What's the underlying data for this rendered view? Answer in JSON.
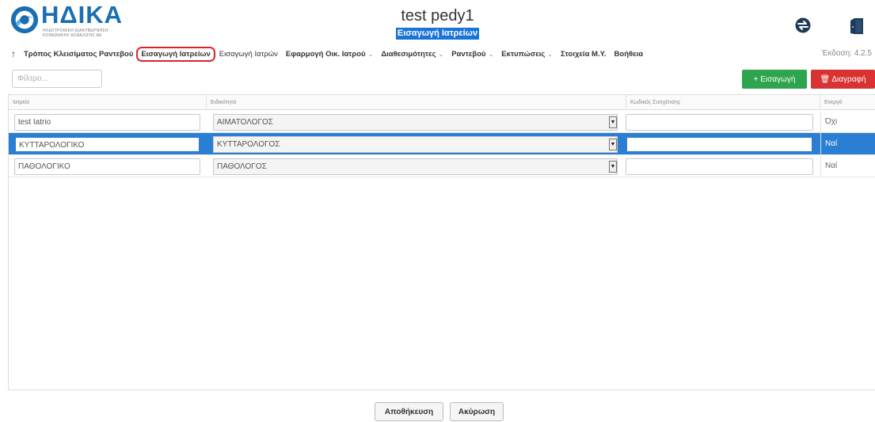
{
  "header": {
    "logo_text": "ΗΔΙΚΑ",
    "logo_subtitle": "ΗΛΕΚΤΡΟΝΙΚΗ ΔΙΑΚΥΒΕΡΝΗΣΗ ΚΟΙΝΩΝΙΚΗΣ ΑΣΦΑΛΙΣΗΣ ΑΕ",
    "app_title": "test pedy1",
    "page_subtitle": "Εισαγωγή Ιατρείων",
    "icons": [
      "swap-icon",
      "exit-door-icon"
    ]
  },
  "menu": {
    "items": [
      {
        "label": "Τρόπος Κλεισίματος Ραντεβού",
        "has_caret": false,
        "active": false,
        "normal": false
      },
      {
        "label": "Εισαγωγή Ιατρείων",
        "has_caret": false,
        "active": true,
        "normal": false
      },
      {
        "label": "Εισαγωγή Ιατρών",
        "has_caret": false,
        "active": false,
        "normal": true
      },
      {
        "label": "Εφαρμογή Οικ. Ιατρού",
        "has_caret": true,
        "active": false,
        "normal": false
      },
      {
        "label": "Διαθεσιμότητες",
        "has_caret": true,
        "active": false,
        "normal": false
      },
      {
        "label": "Ραντεβού",
        "has_caret": true,
        "active": false,
        "normal": false
      },
      {
        "label": "Εκτυπώσεις",
        "has_caret": true,
        "active": false,
        "normal": false
      },
      {
        "label": "Στοιχεία Μ.Υ.",
        "has_caret": false,
        "active": false,
        "normal": false
      },
      {
        "label": "Βοήθεια",
        "has_caret": false,
        "active": false,
        "normal": false
      }
    ],
    "version": "Έκδοση: 4.2.5"
  },
  "toolbar": {
    "filter_placeholder": "Φίλτρο...",
    "add_label": "+ Εισαγωγή",
    "delete_label": "🗑 Διαγραφή",
    "add_color": "#2ea44f",
    "delete_color": "#d93232"
  },
  "grid": {
    "columns": [
      "Ιατρείο",
      "Ειδικότητα",
      "Κωδικός Συσχέτισης",
      "Ενεργό"
    ],
    "rows": [
      {
        "clinic": "test Iatrio",
        "specialty": "ΑΙΜΑΤΟΛΟΓΟΣ",
        "code": "",
        "active": "Όχι",
        "selected": false
      },
      {
        "clinic": "ΚΥΤΤΑΡΟΛΟΓΙΚΟ",
        "specialty": "ΚΥΤΤΑΡΟΛΟΓΟΣ",
        "code": "",
        "active": "Ναί",
        "selected": true
      },
      {
        "clinic": "ΠΑΘΟΛΟΓΙΚΟ",
        "specialty": "ΠΑΘΟΛΟΓΟΣ",
        "code": "",
        "active": "Ναί",
        "selected": false
      }
    ],
    "selection_color": "#2a7fd4"
  },
  "footer": {
    "save_label": "Αποθήκευση",
    "cancel_label": "Ακύρωση"
  }
}
